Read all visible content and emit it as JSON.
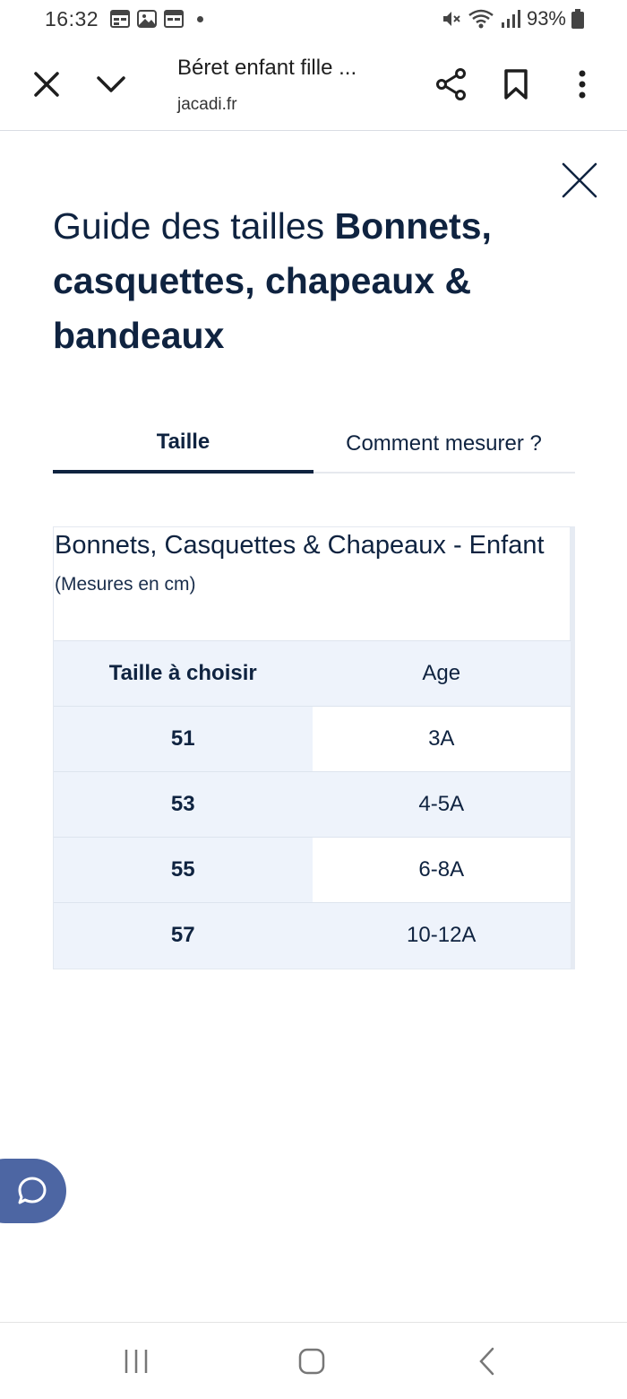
{
  "status_bar": {
    "time": "16:32",
    "battery": "93%",
    "icons_left": [
      "calendar-icon",
      "gallery-icon",
      "calendar-icon"
    ],
    "icons_right": [
      "mute-icon",
      "wifi-icon",
      "signal-icon",
      "battery-icon"
    ]
  },
  "browser": {
    "page_title": "Béret enfant fille ...",
    "url": "jacadi.fr"
  },
  "guide": {
    "title_light": "Guide des tailles ",
    "title_bold": "Bonnets, casquettes, chapeaux & bandeaux"
  },
  "tabs": [
    {
      "label": "Taille",
      "active": true
    },
    {
      "label": "Comment mesurer ?",
      "active": false
    }
  ],
  "table": {
    "title": "Bonnets, Casquettes & Chapeaux - Enfant",
    "subtitle": "(Mesures en cm)",
    "headers": [
      "Taille à choisir",
      "Age"
    ],
    "rows": [
      [
        "51",
        "3A"
      ],
      [
        "53",
        "4-5A"
      ],
      [
        "55",
        "6-8A"
      ],
      [
        "57",
        "10-12A"
      ]
    ]
  },
  "colors": {
    "navy": "#0f2340",
    "table_bg": "#eef3fb",
    "chat_button": "#4d66a3"
  }
}
